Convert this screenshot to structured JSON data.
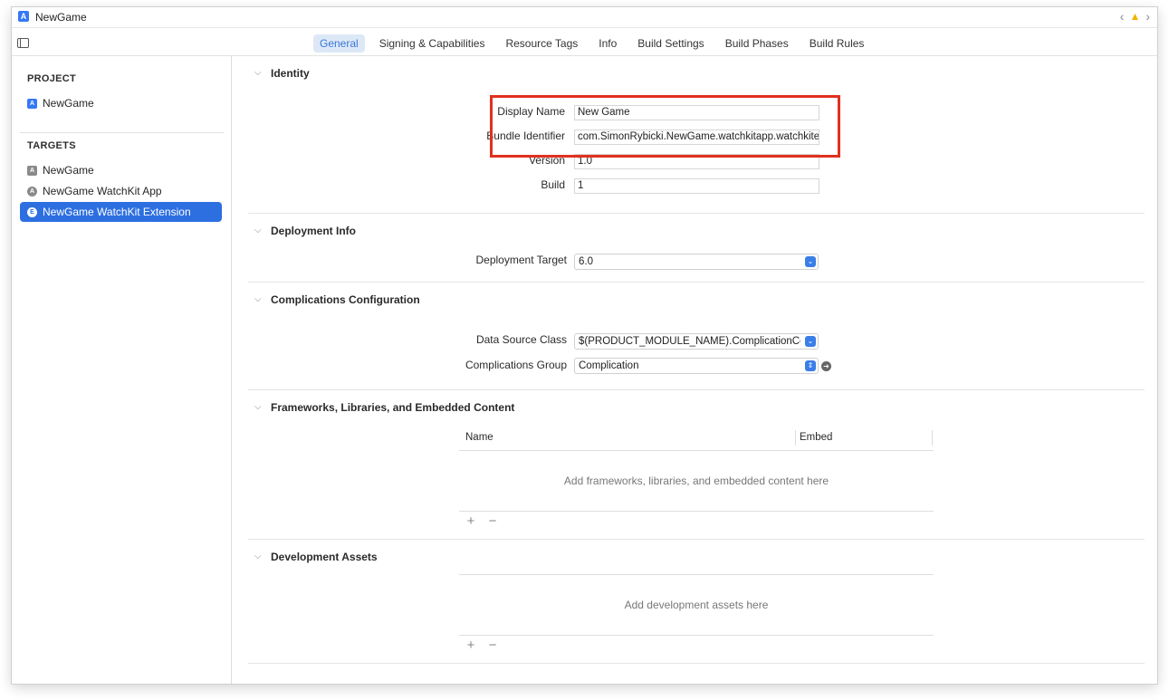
{
  "window": {
    "title": "NewGame"
  },
  "tabs": [
    "General",
    "Signing & Capabilities",
    "Resource Tags",
    "Info",
    "Build Settings",
    "Build Phases",
    "Build Rules"
  ],
  "active_tab": "General",
  "sidebar": {
    "project_header": "PROJECT",
    "project_item": "NewGame",
    "targets_header": "TARGETS",
    "targets": [
      {
        "label": "NewGame",
        "icon": "app-target-icon"
      },
      {
        "label": "NewGame WatchKit App",
        "icon": "watchkit-app-icon"
      },
      {
        "label": "NewGame WatchKit Extension",
        "icon": "extension-icon",
        "selected": true
      }
    ]
  },
  "identity": {
    "title": "Identity",
    "display_name_label": "Display Name",
    "display_name": "New Game",
    "bundle_id_label": "Bundle Identifier",
    "bundle_id": "com.SimonRybicki.NewGame.watchkitapp.watchkitextension",
    "version_label": "Version",
    "version": "1.0",
    "build_label": "Build",
    "build": "1"
  },
  "deployment": {
    "title": "Deployment Info",
    "target_label": "Deployment Target",
    "target_value": "6.0"
  },
  "complications": {
    "title": "Complications Configuration",
    "data_source_label": "Data Source Class",
    "data_source_value": "$(PRODUCT_MODULE_NAME).ComplicationController",
    "group_label": "Complications Group",
    "group_value": "Complication"
  },
  "frameworks": {
    "title": "Frameworks, Libraries, and Embedded Content",
    "col_name": "Name",
    "col_embed": "Embed",
    "empty": "Add frameworks, libraries, and embedded content here",
    "add": "+",
    "remove": "−"
  },
  "dev_assets": {
    "title": "Development Assets",
    "empty": "Add development assets here",
    "add": "+",
    "remove": "−"
  },
  "colors": {
    "accent": "#2d6fe0",
    "highlight": "#e0311e"
  }
}
